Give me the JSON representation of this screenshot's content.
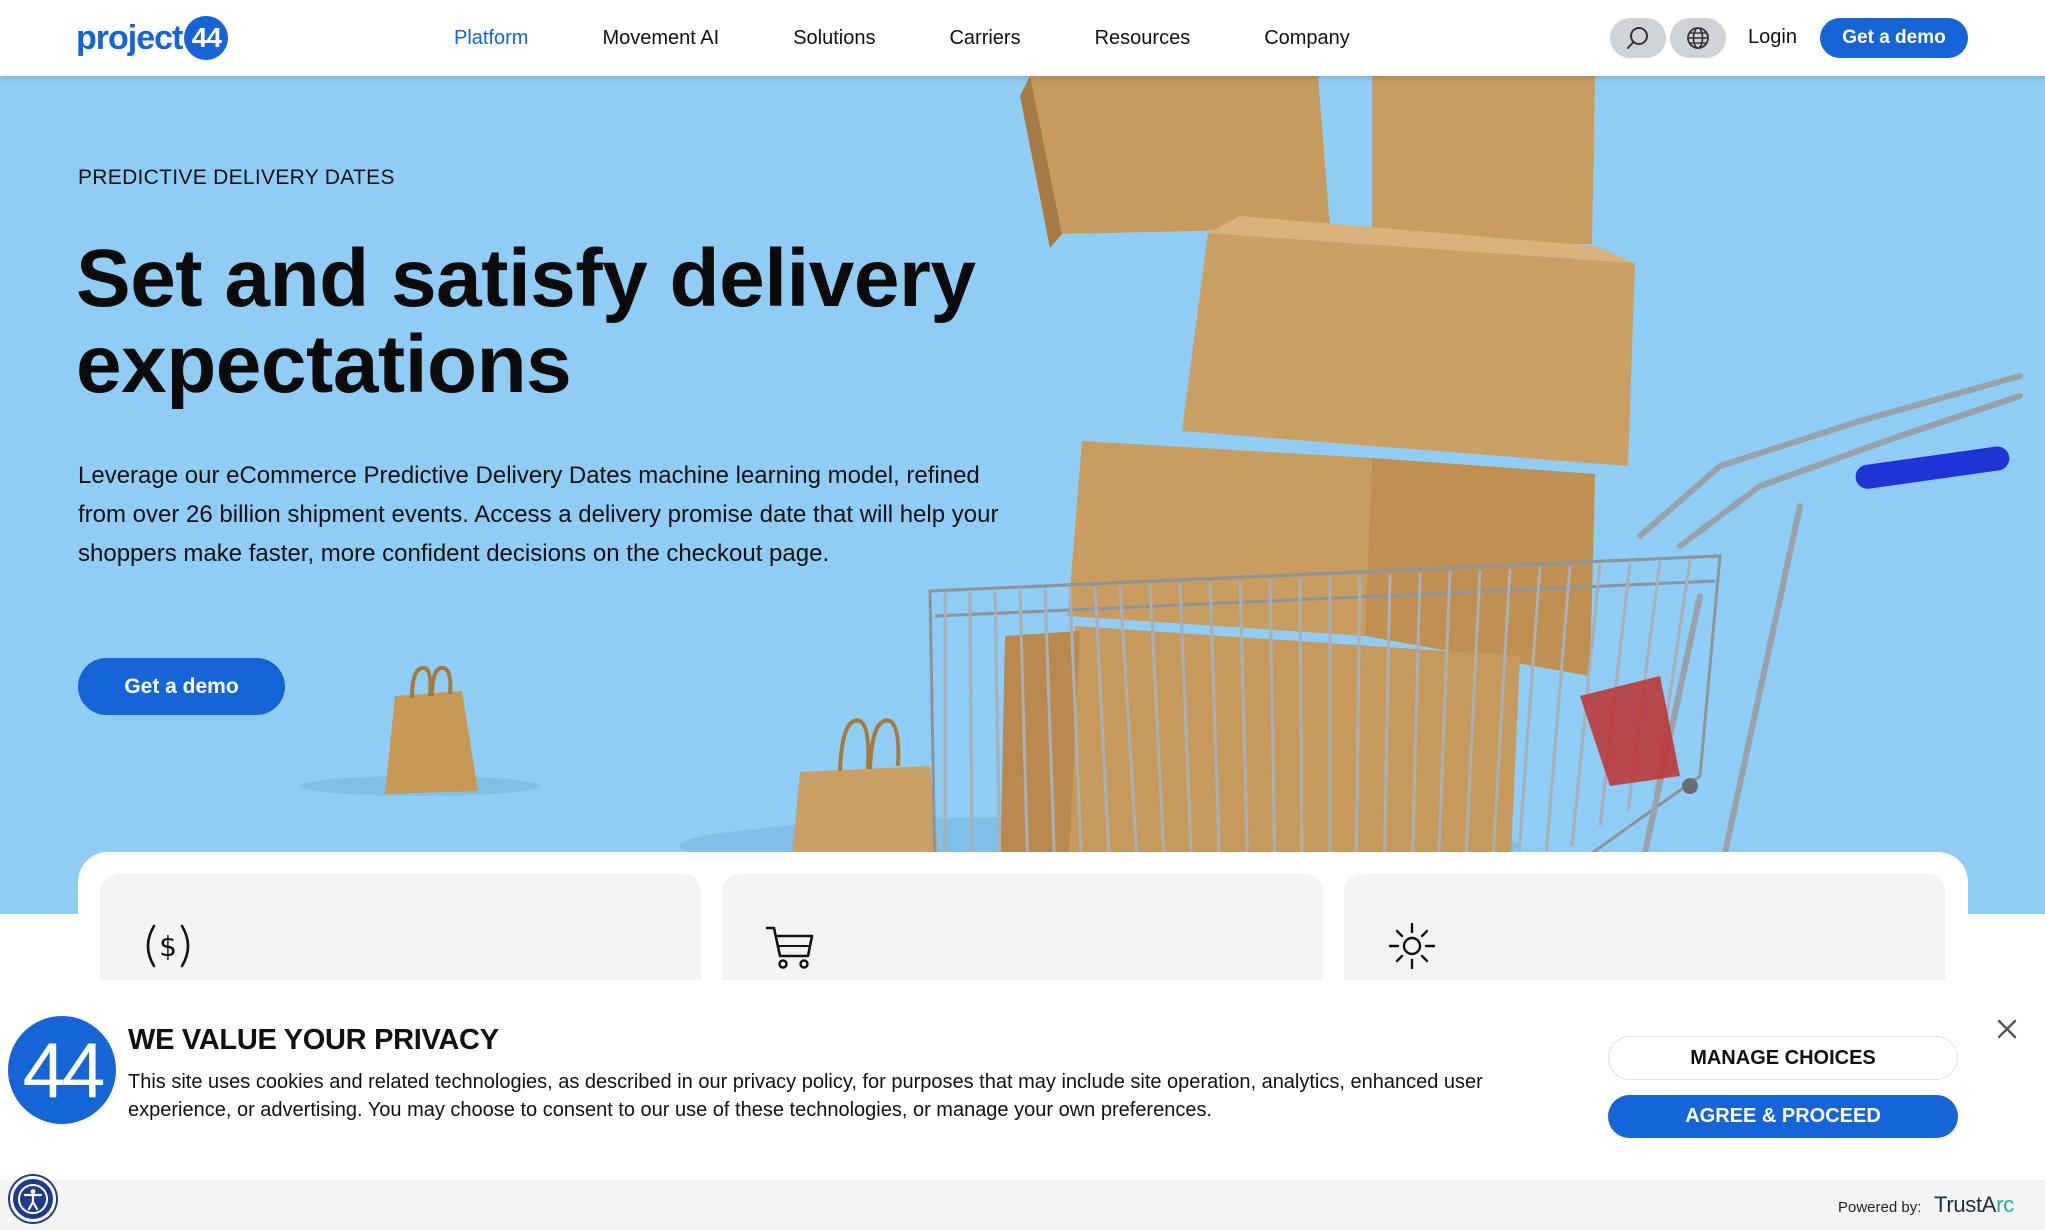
{
  "nav": {
    "logo_text": "project",
    "logo_badge": "44",
    "links": [
      "Platform",
      "Movement AI",
      "Solutions",
      "Carriers",
      "Resources",
      "Company"
    ],
    "active_link": "Platform",
    "search_icon": "search-icon",
    "globe_icon": "globe-icon",
    "login_label": "Login",
    "demo_label": "Get a demo"
  },
  "hero": {
    "eyebrow": "PREDICTIVE DELIVERY DATES",
    "headline": "Set and satisfy delivery expectations",
    "body": "Leverage our eCommerce Predictive Delivery Dates machine learning model, refined from over 26 billion shipment events. Access a delivery promise date that will help your shoppers make faster, more confident decisions on the checkout page.",
    "cta_label": "Get a demo"
  },
  "cards": [
    {
      "icon": "dollar-circle-icon"
    },
    {
      "icon": "shopping-cart-icon"
    },
    {
      "icon": "sun-icon"
    }
  ],
  "privacy": {
    "badge": "44",
    "title": "WE VALUE YOUR PRIVACY",
    "text": "This site uses cookies and related technologies, as described in our privacy policy, for purposes that may include site operation, analytics, enhanced user experience, or advertising. You may choose to consent to our use of these technologies, or manage your own preferences.",
    "manage_label": "MANAGE CHOICES",
    "agree_label": "AGREE & PROCEED",
    "close_icon": "close-icon"
  },
  "footer": {
    "powered_by": "Powered by:",
    "trustarc_a": "TrustA",
    "trustarc_b": "rc"
  },
  "colors": {
    "brand_blue": "#1565d8",
    "hero_sky": "#8fcdf4"
  }
}
